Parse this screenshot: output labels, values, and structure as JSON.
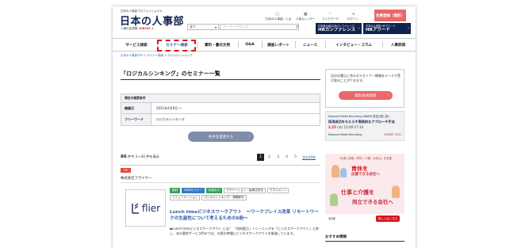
{
  "header": {
    "tagline": "日本の人事部プロフェッショナル",
    "logo": "日本の人事部",
    "members_prefix": "人事の会員数",
    "members_count": "168520",
    "members_suffix": "人",
    "util": [
      {
        "label": "「日本の人事部」とは",
        "icon": "info-icon",
        "glyph": "▢"
      },
      {
        "label": "人事カレンダー",
        "icon": "calendar-icon",
        "glyph": "▦"
      },
      {
        "label": "ブックマーク",
        "icon": "bookmark-icon",
        "glyph": "♡"
      },
      {
        "label": "ログイン",
        "icon": "login-icon",
        "glyph": "⇥"
      }
    ],
    "member_button": "会員登録（無料）",
    "search_select": "全て",
    "search_placeholder": "キーワードを入力",
    "banner1_small": "日本最大級のHRカンファレンス",
    "banner1_big": "HRカンファレンス",
    "banner2_small": "日本の人事部 HRアワード",
    "banner2_big": "HRアワード"
  },
  "nav": [
    "サービス検索",
    "セミナー検索",
    "資料・書式文例",
    "Q&A",
    "調査レポート",
    "ニュース",
    "インタビュー・コラム",
    "人事辞典"
  ],
  "breadcrumb": [
    "日本の人事部TOP",
    "セミナー検索",
    "ロジカルシンキング"
  ],
  "main": {
    "title": "「ロジカルシンキング」のセミナー一覧",
    "conditions_header": "現在の検索条件",
    "conditions": [
      {
        "key": "開催日",
        "value": "2021年2月9日 〜"
      },
      {
        "key": "フリーワード",
        "value": "ロジカルシンキング"
      }
    ],
    "change_button": "条件を変更する",
    "count_total": "86",
    "count_text": "件中 1〜20 件を表示",
    "pages": [
      "1",
      "2",
      "3",
      "4",
      "5"
    ],
    "next_label": "次の20件"
  },
  "card": {
    "badge": "PR",
    "org": "株式会社フライヤー",
    "thumb_text": "flier",
    "tags": [
      {
        "label": "無料",
        "style": "g"
      },
      {
        "label": "WEBセミナー",
        "style": "b"
      },
      {
        "label": "特典あり",
        "style": "g"
      },
      {
        "label": "モチベーション・組織活性化",
        "style": ""
      },
      {
        "label": "マネジメント",
        "style": ""
      },
      {
        "label": "コミュニケーション",
        "style": ""
      },
      {
        "label": "ロジカルシンキング・課題解決",
        "style": ""
      }
    ],
    "title": "Lunch timeビジネスワークアウト　〜ワークプレイス改革 リモートワークの生産性について考えるための6冊〜",
    "desc": "◆Lunch timeビジネスワークアウト とは？ 「知的筋力」トレーニングを「ビジネスワークアウト」と称し、本の要約サービスflierでは、お昼の時間にビジネスワークアウトを推進しています。"
  },
  "sidebar": {
    "notice": "自分の関心に合わせたセミナー情報をメールで受け取ることができます。",
    "notice_button": "無料会員登録",
    "ad1_l1": "Diamond Media Recruiting AWARD 受賞企業に聞く",
    "ad1_l2": "採用成功をもたらす実践的なアプローチ手法",
    "ad1_l3": "2.25",
    "ad1_l3b": "(木) 15:00-17:10",
    "ad1_l4": "Diamond Media Recruiting",
    "ad1_l5": "SUMMIT 2021",
    "ad2_top": "「仕事と家庭（育児・介護）の両立」を支援",
    "ad2_big1": "育休を",
    "ad2_big2": "応援できる会社へ",
    "ad2_big3": "仕事と介護を",
    "ad2_big4": "両立できる会社へ",
    "ad2_foot": "東京都",
    "ad2_button": "詳しくはこちら",
    "recommend_heading": "おすすめ情報"
  },
  "colors": {
    "brand_navy": "#12234f",
    "accent_red": "#e9696a",
    "link_blue": "#2a57a8",
    "highlight": "#d9141b"
  }
}
